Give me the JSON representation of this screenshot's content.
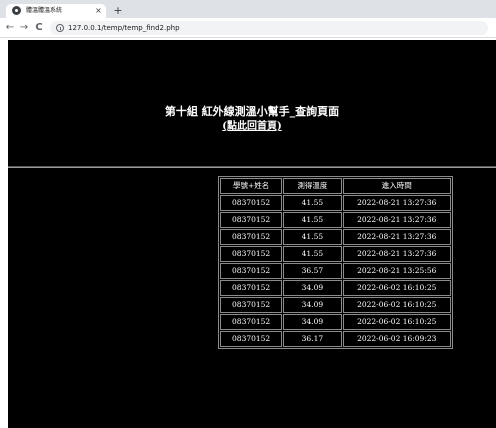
{
  "browser": {
    "tab_title": "體溫體溫系統",
    "tab_close": "×",
    "new_tab": "+",
    "back": "←",
    "forward": "→",
    "reload": "C",
    "url": "127.0.0.1/temp/temp_find2.php"
  },
  "page": {
    "title": "第十組 紅外線測溫小幫手_查詢頁面",
    "home_link": "(點此回首頁)",
    "table": {
      "headers": [
        "學號+姓名",
        "測得溫度",
        "進入時間"
      ],
      "rows": [
        [
          "08370152",
          "41.55",
          "2022-08-21 13:27:36"
        ],
        [
          "08370152",
          "41.55",
          "2022-08-21 13:27:36"
        ],
        [
          "08370152",
          "41.55",
          "2022-08-21 13:27:36"
        ],
        [
          "08370152",
          "41.55",
          "2022-08-21 13:27:36"
        ],
        [
          "08370152",
          "36.57",
          "2022-08-21 13:25:56"
        ],
        [
          "08370152",
          "34.09",
          "2022-06-02 16:10:25"
        ],
        [
          "08370152",
          "34.09",
          "2022-06-02 16:10:25"
        ],
        [
          "08370152",
          "34.09",
          "2022-06-02 16:10:25"
        ],
        [
          "08370152",
          "36.17",
          "2022-06-02 16:09:23"
        ]
      ]
    }
  },
  "colors": {
    "page_background": "#000000",
    "page_text": "#ffffff",
    "tab_strip": "#dee1e6"
  }
}
